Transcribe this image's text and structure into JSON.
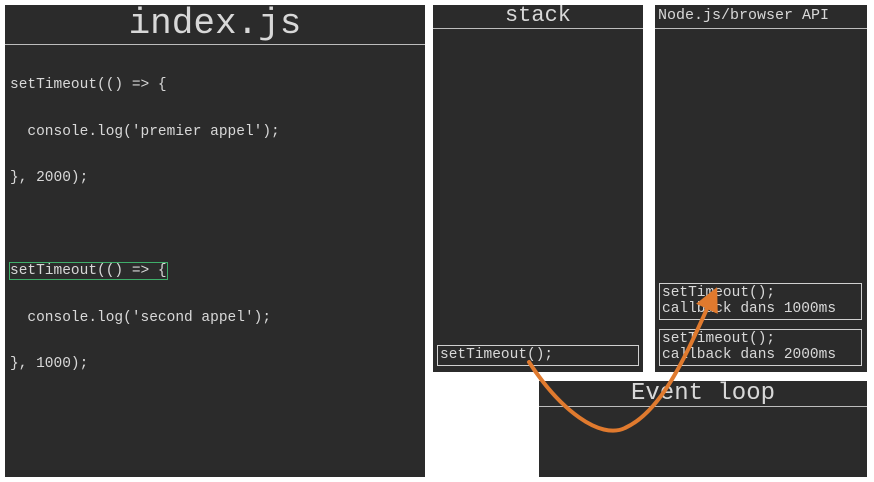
{
  "index_panel": {
    "title": "index.js",
    "code_lines": [
      "setTimeout(() => {",
      "  console.log('premier appel');",
      "}, 2000);",
      "",
      "setTimeout(() => {",
      "  console.log('second appel');",
      "}, 1000);"
    ],
    "highlighted_line": 4
  },
  "stack_panel": {
    "title": "stack",
    "frame": "setTimeout();"
  },
  "api_panel": {
    "title": "Node.js/browser API",
    "timers": [
      {
        "call": "setTimeout();",
        "callback": "callback dans 1000ms"
      },
      {
        "call": "setTimeout();",
        "callback": "callback dans 2000ms"
      }
    ]
  },
  "event_loop_panel": {
    "title": "Event loop"
  },
  "colors": {
    "panel_bg": "#2b2b2b",
    "text": "#d8d8d8",
    "highlight": "#3fae6a",
    "arrow": "#e07a2e"
  }
}
